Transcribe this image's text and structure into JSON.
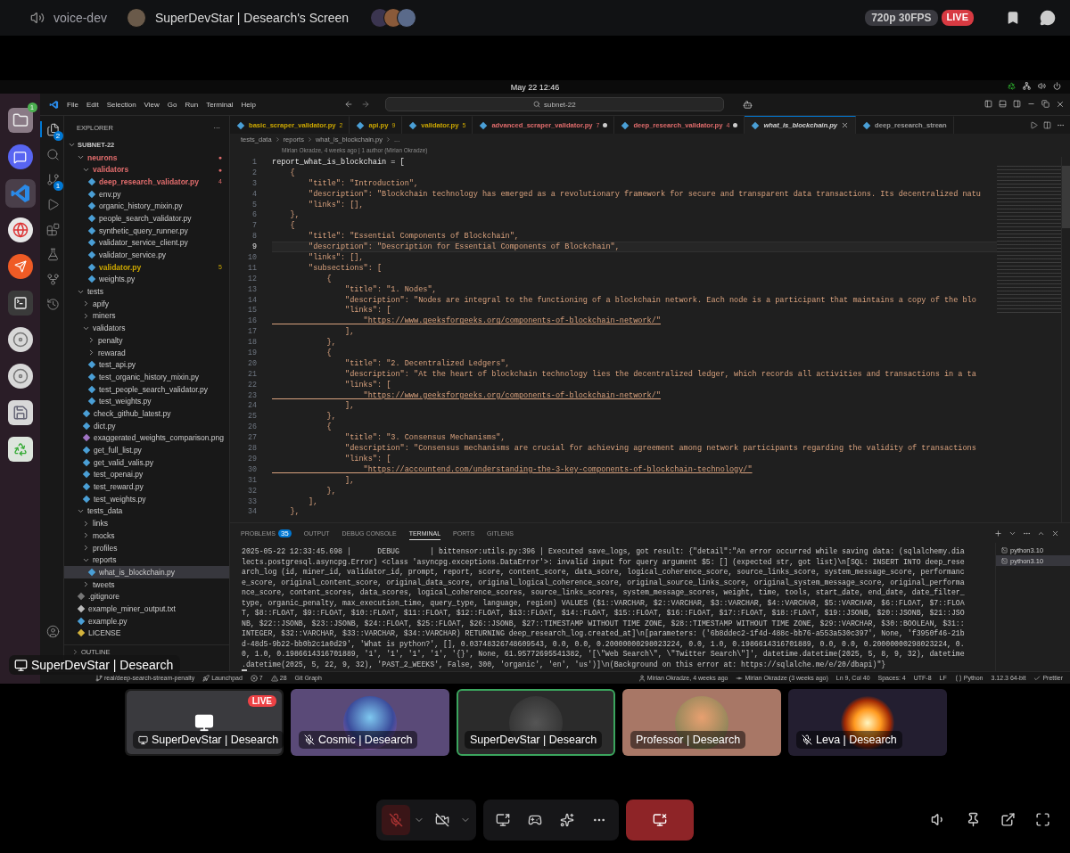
{
  "discord_header": {
    "channel": "voice-dev",
    "stream_title": "SuperDevStar | Desearch's Screen",
    "quality": "720p 30FPS",
    "live_badge": "LIVE"
  },
  "desktop": {
    "clock": "May 22  12:46",
    "dock": [
      {
        "kind": "files",
        "badge": "1",
        "active": false
      },
      {
        "kind": "discord",
        "active": false
      },
      {
        "kind": "vscode",
        "active": true
      },
      {
        "kind": "browser",
        "active": false
      },
      {
        "kind": "postman",
        "active": false
      },
      {
        "kind": "terminal",
        "active": false
      },
      {
        "kind": "disc",
        "active": false
      },
      {
        "kind": "disc",
        "active": false
      },
      {
        "kind": "floppy",
        "active": false
      },
      {
        "kind": "trash",
        "active": false
      }
    ]
  },
  "vscode": {
    "menu": [
      "File",
      "Edit",
      "Selection",
      "View",
      "Go",
      "Run",
      "Terminal",
      "Help"
    ],
    "command_center": "subnet-22",
    "activity_bar": [
      {
        "kind": "explorer",
        "selected": true,
        "badge": "2"
      },
      {
        "kind": "search",
        "selected": false
      },
      {
        "kind": "source-control",
        "selected": false,
        "badge": "1"
      },
      {
        "kind": "run",
        "selected": false
      },
      {
        "kind": "extensions",
        "selected": false
      },
      {
        "kind": "testing",
        "selected": false
      },
      {
        "kind": "git-graph",
        "selected": false
      },
      {
        "kind": "remote",
        "selected": false
      },
      {
        "kind": "account",
        "selected": false
      }
    ],
    "explorer": {
      "title": "EXPLORER",
      "more": "···",
      "root": "SUBNET-22",
      "items": [
        {
          "label": "neurons",
          "kind": "folder",
          "expanded": true,
          "selected": false,
          "color": "#e06c6c",
          "badge": "●",
          "children": [
            {
              "label": "validators",
              "kind": "folder",
              "expanded": true,
              "selected": false,
              "color": "#e06c6c",
              "badge": "●",
              "children": [
                {
                  "label": "deep_research_validator.py",
                  "kind": "python",
                  "selected": false,
                  "color": "#e06c6c",
                  "badge": "4"
                },
                {
                  "label": "env.py",
                  "kind": "python",
                  "selected": false
                },
                {
                  "label": "organic_history_mixin.py",
                  "kind": "python",
                  "selected": false
                },
                {
                  "label": "people_search_validator.py",
                  "kind": "python",
                  "selected": false
                },
                {
                  "label": "synthetic_query_runner.py",
                  "kind": "python",
                  "selected": false
                },
                {
                  "label": "validator_service_client.py",
                  "kind": "python",
                  "selected": false
                },
                {
                  "label": "validator_service.py",
                  "kind": "python",
                  "selected": false
                },
                {
                  "label": "validator.py",
                  "kind": "python",
                  "selected": false,
                  "color": "#cca700",
                  "badge": "5"
                },
                {
                  "label": "weights.py",
                  "kind": "python",
                  "selected": false
                }
              ]
            }
          ]
        },
        {
          "label": "tests",
          "kind": "folder",
          "expanded": true,
          "selected": false,
          "children": [
            {
              "label": "apify",
              "kind": "folder",
              "expanded": false,
              "selected": false
            },
            {
              "label": "miners",
              "kind": "folder",
              "expanded": false,
              "selected": false
            },
            {
              "label": "validators",
              "kind": "folder",
              "expanded": true,
              "selected": false,
              "children": [
                {
                  "label": "penalty",
                  "kind": "folder",
                  "expanded": false,
                  "selected": false
                },
                {
                  "label": "rewarad",
                  "kind": "folder",
                  "expanded": false,
                  "selected": false
                },
                {
                  "label": "test_api.py",
                  "kind": "python",
                  "selected": false
                },
                {
                  "label": "test_organic_history_mixin.py",
                  "kind": "python",
                  "selected": false
                },
                {
                  "label": "test_people_search_validator.py",
                  "kind": "python",
                  "selected": false
                },
                {
                  "label": "test_weights.py",
                  "kind": "python",
                  "selected": false
                }
              ]
            },
            {
              "label": "check_github_latest.py",
              "kind": "python",
              "selected": false
            },
            {
              "label": "dict.py",
              "kind": "python",
              "selected": false
            },
            {
              "label": "exaggerated_weights_comparison.png",
              "kind": "image",
              "selected": false
            },
            {
              "label": "get_full_list.py",
              "kind": "python",
              "selected": false
            },
            {
              "label": "get_valid_valis.py",
              "kind": "python",
              "selected": false
            },
            {
              "label": "test_openai.py",
              "kind": "python",
              "selected": false
            },
            {
              "label": "test_reward.py",
              "kind": "python",
              "selected": false
            },
            {
              "label": "test_weights.py",
              "kind": "python",
              "selected": false
            }
          ]
        },
        {
          "label": "tests_data",
          "kind": "folder",
          "expanded": true,
          "selected": false,
          "children": [
            {
              "label": "links",
              "kind": "folder",
              "expanded": false,
              "selected": false
            },
            {
              "label": "mocks",
              "kind": "folder",
              "expanded": false,
              "selected": false
            },
            {
              "label": "profiles",
              "kind": "folder",
              "expanded": false,
              "selected": false
            },
            {
              "label": "reports",
              "kind": "folder",
              "expanded": true,
              "selected": false,
              "children": [
                {
                  "label": "what_is_blockchain.py",
                  "kind": "python",
                  "selected": true
                }
              ]
            },
            {
              "label": "tweets",
              "kind": "folder",
              "expanded": false,
              "selected": false
            }
          ]
        },
        {
          "label": ".gitignore",
          "kind": "gitignore",
          "selected": false
        },
        {
          "label": "example_miner_output.txt",
          "kind": "text",
          "selected": false
        },
        {
          "label": "example.py",
          "kind": "python",
          "selected": false
        },
        {
          "label": "LICENSE",
          "kind": "license",
          "selected": false
        }
      ],
      "outline": "OUTLINE"
    },
    "tabs": [
      {
        "label": "basic_scraper_validator.py",
        "badge": "2",
        "color": "#cca700",
        "dirty": false,
        "selected": false
      },
      {
        "label": "api.py",
        "badge": "9",
        "color": "#cca700",
        "dirty": false,
        "selected": false
      },
      {
        "label": "validator.py",
        "badge": "5",
        "color": "#cca700",
        "dirty": false,
        "selected": false
      },
      {
        "label": "advanced_scraper_validator.py",
        "badge": "7",
        "color": "#e06c6c",
        "dirty": true,
        "selected": false
      },
      {
        "label": "deep_research_validator.py",
        "badge": "4",
        "color": "#e06c6c",
        "dirty": true,
        "selected": false
      },
      {
        "label": "what_is_blockchain.py",
        "color": "#d4d4d4",
        "dirty": false,
        "selected": true
      },
      {
        "label": "deep_research_strean",
        "color": "#9d9d9d",
        "dirty": false,
        "selected": false
      }
    ],
    "breadcrumb": [
      "tests_data",
      "reports",
      "what_is_blockchain.py",
      "..."
    ],
    "blame": "Mirian Okradze, 4 weeks ago | 1 author (Mirian Okradze)",
    "code_lines": [
      {
        "n": "1",
        "kind": "ident",
        "active": false,
        "text": "report_what_is_blockchain = ["
      },
      {
        "n": "2",
        "kind": "code",
        "active": false,
        "text": "    {"
      },
      {
        "n": "3",
        "kind": "code",
        "active": false,
        "text": "        \"title\": \"Introduction\","
      },
      {
        "n": "4",
        "kind": "code",
        "active": false,
        "text": "        \"description\": \"Blockchain technology has emerged as a revolutionary framework for secure and transparent data transactions. Its decentralized natu"
      },
      {
        "n": "5",
        "kind": "code",
        "active": false,
        "text": "        \"links\": [],"
      },
      {
        "n": "6",
        "kind": "code",
        "active": false,
        "text": "    },"
      },
      {
        "n": "7",
        "kind": "code",
        "active": false,
        "text": "    {"
      },
      {
        "n": "8",
        "kind": "code",
        "active": false,
        "text": "        \"title\": \"Essential Components of Blockchain\","
      },
      {
        "n": "9",
        "kind": "code",
        "active": true,
        "text": "        \"description\": \"Description for Essential Components of Blockchain\","
      },
      {
        "n": "10",
        "kind": "code",
        "active": false,
        "text": "        \"links\": [],"
      },
      {
        "n": "11",
        "kind": "code",
        "active": false,
        "text": "        \"subsections\": ["
      },
      {
        "n": "12",
        "kind": "code",
        "active": false,
        "text": "            {"
      },
      {
        "n": "13",
        "kind": "code",
        "active": false,
        "text": "                \"title\": \"1. Nodes\","
      },
      {
        "n": "14",
        "kind": "code",
        "active": false,
        "text": "                \"description\": \"Nodes are integral to the functioning of a blockchain network. Each node is a participant that maintains a copy of the blo"
      },
      {
        "n": "15",
        "kind": "code",
        "active": false,
        "text": "                \"links\": ["
      },
      {
        "n": "16",
        "kind": "link",
        "active": false,
        "text": "                    \"https://www.geeksforgeeks.org/components-of-blockchain-network/\""
      },
      {
        "n": "17",
        "kind": "code",
        "active": false,
        "text": "                ],"
      },
      {
        "n": "18",
        "kind": "code",
        "active": false,
        "text": "            },"
      },
      {
        "n": "19",
        "kind": "code",
        "active": false,
        "text": "            {"
      },
      {
        "n": "20",
        "kind": "code",
        "active": false,
        "text": "                \"title\": \"2. Decentralized Ledgers\","
      },
      {
        "n": "21",
        "kind": "code",
        "active": false,
        "text": "                \"description\": \"At the heart of blockchain technology lies the decentralized ledger, which records all activities and transactions in a ta"
      },
      {
        "n": "22",
        "kind": "code",
        "active": false,
        "text": "                \"links\": ["
      },
      {
        "n": "23",
        "kind": "link",
        "active": false,
        "text": "                    \"https://www.geeksforgeeks.org/components-of-blockchain-network/\""
      },
      {
        "n": "24",
        "kind": "code",
        "active": false,
        "text": "                ],"
      },
      {
        "n": "25",
        "kind": "code",
        "active": false,
        "text": "            },"
      },
      {
        "n": "26",
        "kind": "code",
        "active": false,
        "text": "            {"
      },
      {
        "n": "27",
        "kind": "code",
        "active": false,
        "text": "                \"title\": \"3. Consensus Mechanisms\","
      },
      {
        "n": "28",
        "kind": "code",
        "active": false,
        "text": "                \"description\": \"Consensus mechanisms are crucial for achieving agreement among network participants regarding the validity of transactions"
      },
      {
        "n": "29",
        "kind": "code",
        "active": false,
        "text": "                \"links\": ["
      },
      {
        "n": "30",
        "kind": "link",
        "active": false,
        "text": "                    \"https://accountend.com/understanding-the-3-key-components-of-blockchain-technology/\""
      },
      {
        "n": "31",
        "kind": "code",
        "active": false,
        "text": "                ],"
      },
      {
        "n": "32",
        "kind": "code",
        "active": false,
        "text": "            },"
      },
      {
        "n": "33",
        "kind": "code",
        "active": false,
        "text": "        ],"
      },
      {
        "n": "34",
        "kind": "code",
        "active": false,
        "text": "    },"
      }
    ],
    "panel": {
      "tabs": [
        {
          "label": "PROBLEMS",
          "badge": "35",
          "selected": false
        },
        {
          "label": "OUTPUT",
          "selected": false
        },
        {
          "label": "DEBUG CONSOLE",
          "selected": false
        },
        {
          "label": "TERMINAL",
          "selected": true
        },
        {
          "label": "PORTS",
          "selected": false
        },
        {
          "label": "GITLENS",
          "selected": false
        }
      ],
      "terminal_lines": [
        "2025-05-22 12:33:45.698 |      DEBUG       | bittensor:utils.py:396 | Executed save_logs, got result: {\"detail\":\"An error occurred while saving data: (sqlalchemy.dia",
        "lects.postgresql.asyncpg.Error) <class 'asyncpg.exceptions.DataError'>: invalid input for query argument $5: [] (expected str, got list)\\n[SQL: INSERT INTO deep_rese",
        "arch_log (id, miner_id, validator_id, prompt, report, score, content_score, data_score, logical_coherence_score, source_links_score, system_message_score, performanc",
        "e_score, original_content_score, original_data_score, original_logical_coherence_score, original_source_links_score, original_system_message_score, original_performa",
        "nce_score, content_scores, data_scores, logical_coherence_scores, source_links_scores, system_message_scores, weight, time, tools, start_date, end_date, date_filter_",
        "type, organic_penalty, max_execution_time, query_type, language, region) VALUES ($1::VARCHAR, $2::VARCHAR, $3::VARCHAR, $4::VARCHAR, $5::VARCHAR, $6::FLOAT, $7::FLOA",
        "T, $8::FLOAT, $9::FLOAT, $10::FLOAT, $11::FLOAT, $12::FLOAT, $13::FLOAT, $14::FLOAT, $15::FLOAT, $16::FLOAT, $17::FLOAT, $18::FLOAT, $19::JSONB, $20::JSONB, $21::JSO",
        "NB, $22::JSONB, $23::JSONB, $24::FLOAT, $25::FLOAT, $26::JSONB, $27::TIMESTAMP WITHOUT TIME ZONE, $28::TIMESTAMP WITHOUT TIME ZONE, $29::VARCHAR, $30::BOOLEAN, $31::",
        "INTEGER, $32::VARCHAR, $33::VARCHAR, $34::VARCHAR) RETURNING deep_research_log.created_at]\\n[parameters: ('6b8ddec2-1f4d-488c-bb76-a553a530c397', None, 'f3950f46-21b",
        "d-48d5-9b22-bb0b2c1a0d29', 'What is python?', [], 0.03748326748609543, 0.0, 0.0, 0.20000000298023224, 0.0, 1.0, 0.1986614316701889, 0.0, 0.0, 0.20000000298023224, 0.",
        "0, 1.0, 0.1986614316701889, '1', '1', '1', '1', '{}', None, 61.95772695541382, '[\\\"Web Search\\\", \\\"Twitter Search\\\"]', datetime.datetime(2025, 5, 8, 9, 32), datetime",
        ".datetime(2025, 5, 22, 9, 32), 'PAST_2_WEEKS', False, 300, 'organic', 'en', 'us')]\\n(Background on this error at: https://sqlalche.me/e/20/dbapi)\"}"
      ],
      "terminals": [
        {
          "label": "python3.10",
          "selected": false
        },
        {
          "label": "python3.10",
          "selected": true
        }
      ]
    },
    "status_bar": {
      "left": [
        {
          "kind": "branch",
          "text": "real/deep-search-stream-penalty"
        },
        {
          "kind": "launchpad",
          "text": "Launchpad"
        },
        {
          "kind": "errors",
          "text": "7"
        },
        {
          "kind": "warnings",
          "text": "28"
        },
        {
          "kind": "plain",
          "text": "Git Graph"
        }
      ],
      "right": [
        {
          "kind": "person",
          "text": "Mirian Okradze, 4 weeks ago"
        },
        {
          "kind": "commit",
          "text": "Mirian Okradze (3 weeks ago)"
        },
        {
          "kind": "plain",
          "text": "Ln 9, Col 40"
        },
        {
          "kind": "plain",
          "text": "Spaces: 4"
        },
        {
          "kind": "plain",
          "text": "UTF-8"
        },
        {
          "kind": "plain",
          "text": "LF"
        },
        {
          "kind": "braces",
          "text": "Python"
        },
        {
          "kind": "plain",
          "text": "3.12.3 64-bit"
        },
        {
          "kind": "check",
          "text": "Prettier"
        }
      ]
    }
  },
  "stream_label": "SuperDevStar | Desearch",
  "tiles": [
    {
      "kind": "stream",
      "name": "SuperDevStar | Desearch",
      "live_badge": "LIVE",
      "muted": false,
      "speaking": false,
      "color": "#1c1c1c"
    },
    {
      "kind": "user",
      "name": "Cosmic | Desearch",
      "muted": true,
      "speaking": false,
      "color": "#5a4a78"
    },
    {
      "kind": "user",
      "name": "SuperDevStar | Desearch",
      "muted": false,
      "speaking": true,
      "color": "#2b2b2b"
    },
    {
      "kind": "user",
      "name": "Professor | Desearch",
      "muted": false,
      "speaking": false,
      "color": "#a87766"
    },
    {
      "kind": "user",
      "name": "Leva | Desearch",
      "muted": true,
      "speaking": false,
      "color": "#231e30"
    }
  ],
  "controls": {
    "mic_muted": true,
    "camera_off": true
  }
}
